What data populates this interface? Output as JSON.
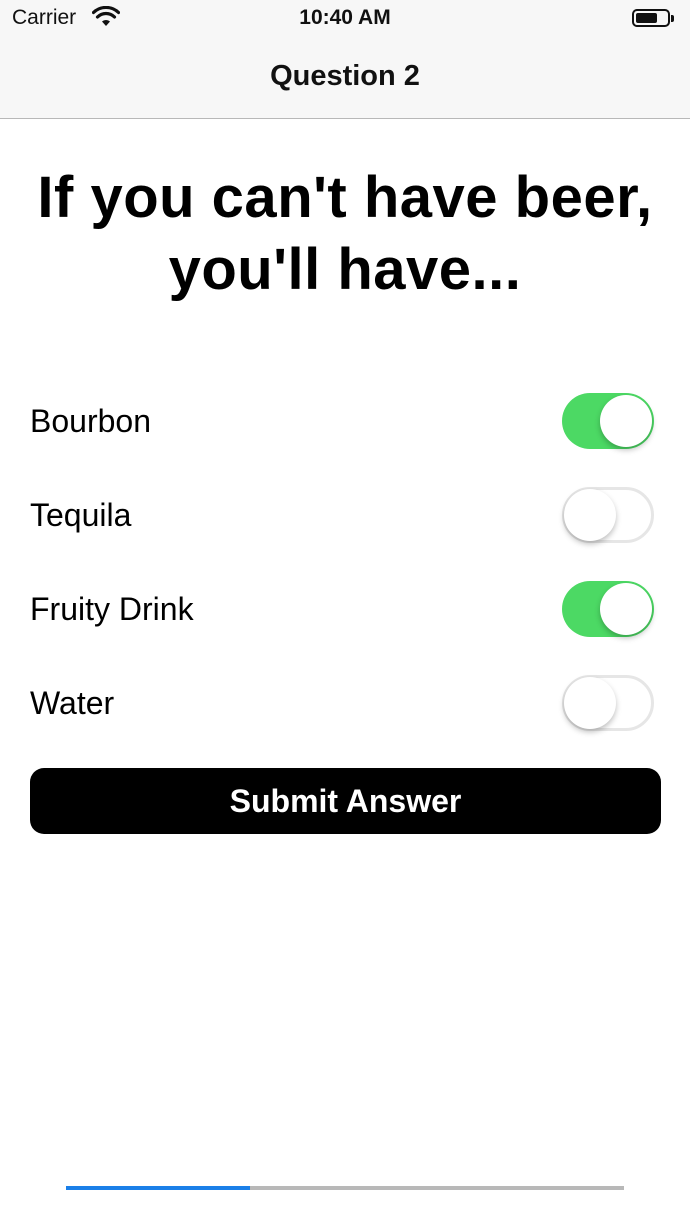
{
  "status_bar": {
    "carrier": "Carrier",
    "time": "10:40 AM",
    "wifi_icon": "wifi-icon",
    "battery_icon": "battery-icon",
    "battery_level": 0.7
  },
  "nav": {
    "title": "Question 2"
  },
  "question": {
    "text": "If you can't have beer, you'll have..."
  },
  "options": [
    {
      "label": "Bourbon",
      "on": true
    },
    {
      "label": "Tequila",
      "on": false
    },
    {
      "label": "Fruity Drink",
      "on": true
    },
    {
      "label": "Water",
      "on": false
    }
  ],
  "colors": {
    "switch_on": "#4cd964",
    "switch_off_border": "#e6e6e6",
    "progress": "#1a7fe8",
    "button_bg": "#000000"
  },
  "submit": {
    "label": "Submit Answer"
  },
  "progress": {
    "value": 0.33
  }
}
